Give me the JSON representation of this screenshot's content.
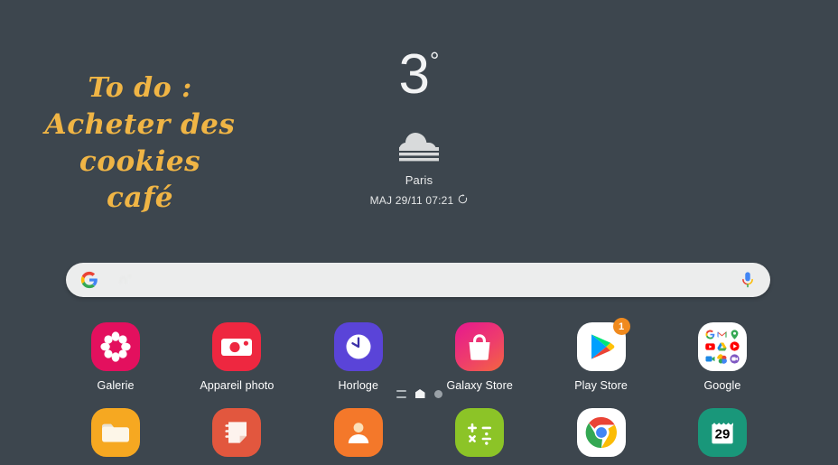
{
  "background_color": "#3d464e",
  "note": {
    "name": "to-do-sticker",
    "color": "#f0b545",
    "lines": [
      "To do :",
      "Acheter des",
      "cookies",
      "café"
    ]
  },
  "weather": {
    "temperature": "3",
    "degree_symbol": "°",
    "condition_icon": "fog-cloud-icon",
    "city": "Paris",
    "updated": "MAJ 29/11 07:21",
    "refresh_icon": "refresh-icon"
  },
  "search": {
    "google_icon": "google-g-icon",
    "ghost_text": "∩’",
    "placeholder": "",
    "mic_icon": "google-mic-icon"
  },
  "apps_row1": [
    {
      "label": "Galerie",
      "icon": "gallery-icon",
      "color": "#e3105e"
    },
    {
      "label": "Appareil photo",
      "icon": "camera-icon",
      "color": "#ee2740"
    },
    {
      "label": "Horloge",
      "icon": "clock-icon",
      "color": "#5a44d8"
    },
    {
      "label": "Galaxy Store",
      "icon": "galaxy-store-icon",
      "color": "#e6178f"
    },
    {
      "label": "Play Store",
      "icon": "play-store-icon",
      "color": "#ffffff",
      "badge": "1",
      "badge_color": "#f08a1e"
    },
    {
      "label": "Google",
      "icon": "google-folder-icon",
      "color": "#ffffff"
    }
  ],
  "apps_row2": [
    {
      "label": "",
      "icon": "my-files-icon",
      "color": "#f6a821"
    },
    {
      "label": "",
      "icon": "notes-icon",
      "color": "#e2573e"
    },
    {
      "label": "",
      "icon": "contacts-icon",
      "color": "#f4782a"
    },
    {
      "label": "",
      "icon": "calculator-icon",
      "color": "#8cc427",
      "glyphs": "+ − × ÷"
    },
    {
      "label": "",
      "icon": "chrome-icon",
      "color": "#ffffff"
    },
    {
      "label": "",
      "icon": "calendar-icon",
      "color": "#19977a",
      "day": "29"
    }
  ],
  "google_folder_apps": [
    {
      "name": "google-search-mini-icon",
      "letter": "G",
      "color": "#ffffff"
    },
    {
      "name": "gmail-mini-icon",
      "letter": "M",
      "color": "#ffffff"
    },
    {
      "name": "maps-mini-icon",
      "letter": "",
      "color": "#ffffff"
    },
    {
      "name": "youtube-mini-icon",
      "letter": "",
      "color": "#ffffff"
    },
    {
      "name": "drive-mini-icon",
      "letter": "",
      "color": "#ffffff"
    },
    {
      "name": "youtube-music-mini-icon",
      "letter": "",
      "color": "#ffffff"
    },
    {
      "name": "meet-mini-icon",
      "letter": "",
      "color": "#ffffff"
    },
    {
      "name": "photos-mini-icon",
      "letter": "",
      "color": "#ffffff"
    },
    {
      "name": "duo-mini-icon",
      "letter": "",
      "color": "#ffffff"
    }
  ],
  "page_indicator": {
    "app_list_icon": "app-list-icon",
    "home_icon": "home-page-icon",
    "other_page_dot": "page-dot"
  }
}
